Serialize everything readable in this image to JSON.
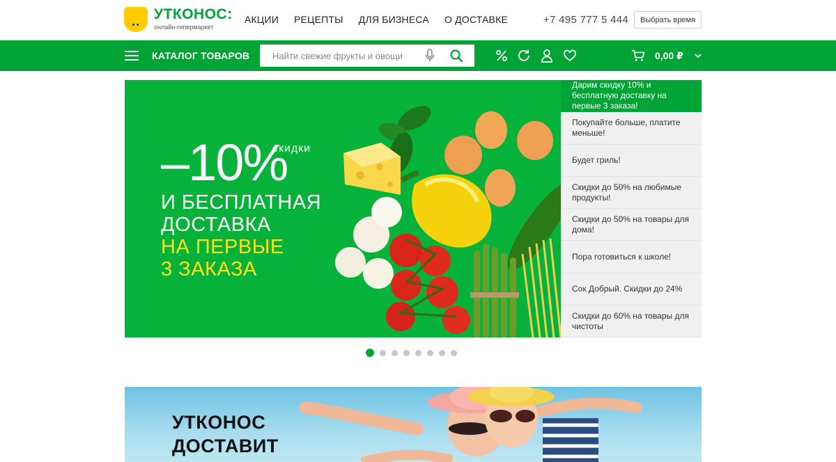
{
  "header": {
    "logo_name": "УТКОНОС:",
    "logo_sub": "онлайн-гипермаркет",
    "nav": [
      "АКЦИИ",
      "РЕЦЕПТЫ",
      "ДЛЯ БИЗНЕСА",
      "О ДОСТАВКЕ"
    ],
    "phone": "+7 495 777 5 444",
    "time_button": "Выбрать время"
  },
  "greenbar": {
    "catalog_label": "КАТАЛОГ ТОВАРОВ",
    "search_placeholder": "Найти свежие фрукты и овощи",
    "cart_total": "0,00 ₽",
    "icons": [
      "percent-icon",
      "history-icon",
      "user-icon",
      "heart-icon",
      "cart-icon"
    ]
  },
  "hero": {
    "discount": "–10%",
    "discount_word": "скидки",
    "line1": "И БЕСПЛАТНАЯ",
    "line2": "ДОСТАВКА",
    "line3": "НА ПЕРВЫЕ",
    "line4": "3 ЗАКАЗА"
  },
  "promo_list": [
    "Дарим скидку 10% и бесплатную доставку на первые 3 заказа!",
    "Покупайте больше, платите меньше!",
    "Будет гриль!",
    "Скидки до 50% на любимые продукты!",
    "Скидки до 50% на товары для дома!",
    "Пора готовиться к школе!",
    "Сок Добрый. Скидки до 24%",
    "Скидки до 60% на товары для чистоты"
  ],
  "slider": {
    "count": 8,
    "active": 0
  },
  "banner2": {
    "line1": "УТКОНОС",
    "line2": "ДОСТАВИТ"
  },
  "colors": {
    "brand_green": "#00a436",
    "hero_green": "#07b23a",
    "logo_yellow": "#ffcc00",
    "hero_accent": "#ffe11a"
  }
}
